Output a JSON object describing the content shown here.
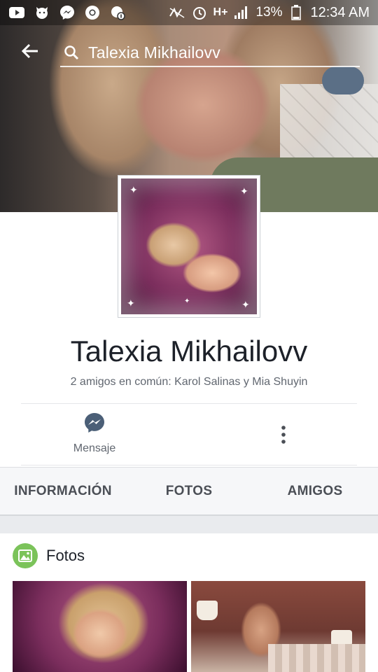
{
  "status_bar": {
    "icons_left": [
      "youtube-icon",
      "wolf-app-icon",
      "messenger-icon",
      "chrome-icon",
      "notification-icon"
    ],
    "icons_right": [
      "nfc-icon",
      "alarm-icon",
      "hplus-icon",
      "signal-icon",
      "battery-icon"
    ],
    "network": "H+",
    "battery": "13%",
    "time": "12:34 AM"
  },
  "header": {
    "search_text": "Talexia Mikhailovv"
  },
  "profile": {
    "name": "Talexia Mikhailovv",
    "mutual_friends": "2 amigos en común: Karol Salinas y Mia Shuyin",
    "message_label": "Mensaje"
  },
  "tabs": [
    {
      "label": "INFORMACIÓN"
    },
    {
      "label": "FOTOS"
    },
    {
      "label": "AMIGOS"
    }
  ],
  "photos": {
    "title": "Fotos"
  },
  "colors": {
    "messenger_blue": "#4b5f77",
    "photos_green": "#7bc35a",
    "text_dark": "#1d2129",
    "text_muted": "#616770"
  }
}
